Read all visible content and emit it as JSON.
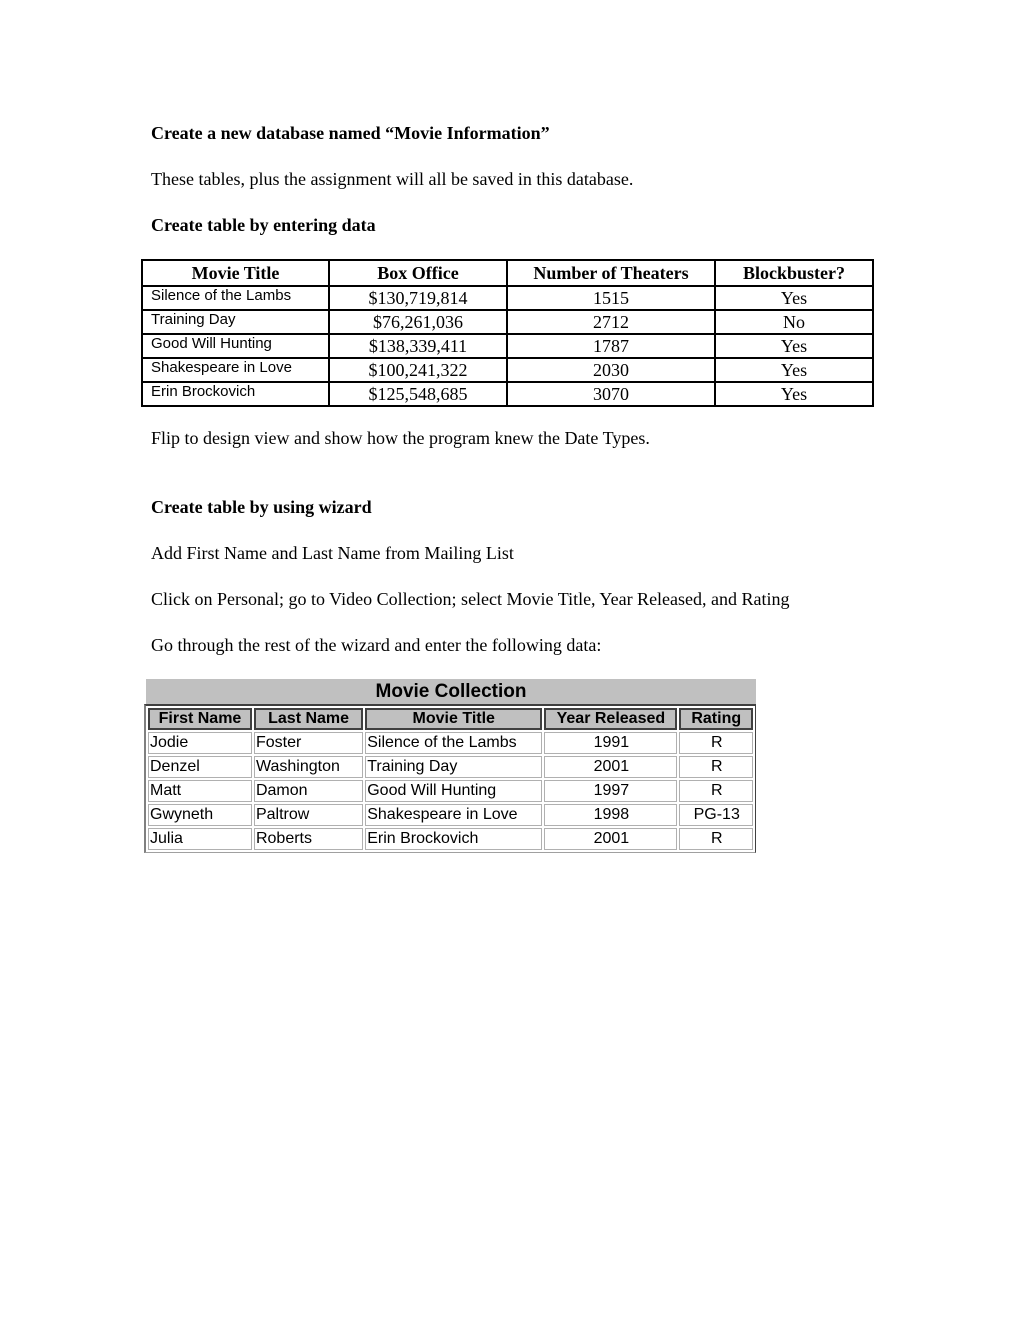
{
  "document": {
    "heading1": "Create a new database named “Movie Information”",
    "para1": "These tables, plus the assignment will all be saved in this database.",
    "heading2": "Create table by entering data",
    "para2": "Flip to design view and show how the program knew the Date Types.",
    "heading3": "Create table by using wizard",
    "para3": "Add First Name and Last Name from Mailing List",
    "para4": "Click on Personal; go to Video Collection; select Movie Title, Year Released, and Rating",
    "para5": "Go through the rest of the wizard and enter the following data:"
  },
  "table1": {
    "headers": [
      "Movie Title",
      "Box Office",
      "Number of Theaters",
      "Blockbuster?"
    ],
    "rows": [
      [
        "Silence of the Lambs",
        "$130,719,814",
        "1515",
        "Yes"
      ],
      [
        "Training Day",
        "$76,261,036",
        "2712",
        "No"
      ],
      [
        "Good Will Hunting",
        "$138,339,411",
        "1787",
        "Yes"
      ],
      [
        "Shakespeare in Love",
        "$100,241,322",
        "2030",
        "Yes"
      ],
      [
        "Erin Brockovich",
        "$125,548,685",
        "3070",
        "Yes"
      ]
    ]
  },
  "table2": {
    "caption": "Movie Collection",
    "headers": [
      "First Name",
      "Last Name",
      "Movie Title",
      "Year Released",
      "Rating"
    ],
    "rows": [
      [
        "Jodie",
        "Foster",
        "Silence of the Lambs",
        "1991",
        "R"
      ],
      [
        "Denzel",
        "Washington",
        "Training Day",
        "2001",
        "R"
      ],
      [
        "Matt",
        "Damon",
        "Good Will Hunting",
        "1997",
        "R"
      ],
      [
        "Gwyneth",
        "Paltrow",
        "Shakespeare in Love",
        "1998",
        "PG-13"
      ],
      [
        "Julia",
        "Roberts",
        "Erin Brockovich",
        "2001",
        "R"
      ]
    ]
  }
}
